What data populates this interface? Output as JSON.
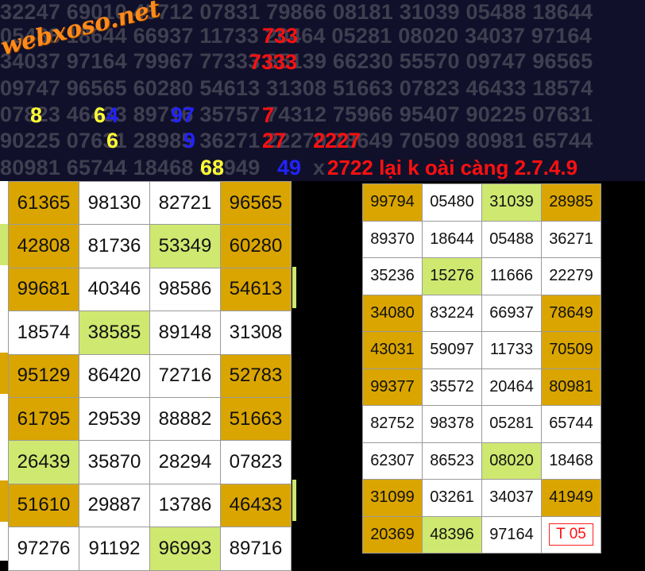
{
  "logo_text": "webxoso.net",
  "bg_rows": [
    "32247 69010 45712 07831 79866 08181 31039 05488 18644",
    "05488 18644 66937 11733 20464 05281 08020 34037 97164",
    "34037 97164 79967 77333 85139 66230 55570 09747 96565",
    "09747 96565 60280 54613 31308 51663 07823 46433 18574",
    "07823 46433 89716 35757 74312 75966 95407 90225 07631",
    "90225 07631 28985 36271 22279 78649 70509 80981 65744",
    "80981 65744 18468 41949"
  ],
  "highlights": {
    "r1": "733",
    "r2": "7333",
    "r4_8": "8",
    "r4_6": "6",
    "r4_4": "4",
    "r4_97": "97",
    "r4_7": "7",
    "r5_6": "6",
    "r5_9": "9",
    "r5_27": "27",
    "r5_2227": "2227",
    "r6_68": "68",
    "r6_49": "49",
    "r6_x": "x",
    "r6_note": "2722 lại k oài càng 2.7.4.9"
  },
  "colors": {
    "orange": "#daa500",
    "green": "#cfe870",
    "white": "#ffffff"
  },
  "left_table": [
    [
      [
        "61365",
        "o"
      ],
      [
        "98130",
        "w"
      ],
      [
        "82721",
        "w"
      ],
      [
        "96565",
        "o"
      ]
    ],
    [
      [
        "42808",
        "o"
      ],
      [
        "81736",
        "w"
      ],
      [
        "53349",
        "g"
      ],
      [
        "60280",
        "o"
      ]
    ],
    [
      [
        "99681",
        "o"
      ],
      [
        "40346",
        "w"
      ],
      [
        "98586",
        "w"
      ],
      [
        "54613",
        "o"
      ]
    ],
    [
      [
        "18574",
        "w"
      ],
      [
        "38585",
        "g"
      ],
      [
        "89148",
        "w"
      ],
      [
        "31308",
        "w"
      ]
    ],
    [
      [
        "95129",
        "o"
      ],
      [
        "86420",
        "w"
      ],
      [
        "72716",
        "w"
      ],
      [
        "52783",
        "o"
      ]
    ],
    [
      [
        "61795",
        "o"
      ],
      [
        "29539",
        "w"
      ],
      [
        "88882",
        "w"
      ],
      [
        "51663",
        "o"
      ]
    ],
    [
      [
        "26439",
        "g"
      ],
      [
        "35870",
        "w"
      ],
      [
        "28294",
        "w"
      ],
      [
        "07823",
        "w"
      ]
    ],
    [
      [
        "51610",
        "o"
      ],
      [
        "29887",
        "w"
      ],
      [
        "13786",
        "w"
      ],
      [
        "46433",
        "o"
      ]
    ],
    [
      [
        "97276",
        "w"
      ],
      [
        "91192",
        "w"
      ],
      [
        "96993",
        "g"
      ],
      [
        "89716",
        "w"
      ]
    ]
  ],
  "right_table": [
    [
      [
        "99794",
        "o"
      ],
      [
        "05480",
        "w"
      ],
      [
        "31039",
        "g"
      ],
      [
        "28985",
        "o"
      ]
    ],
    [
      [
        "89370",
        "w"
      ],
      [
        "18644",
        "w"
      ],
      [
        "05488",
        "w"
      ],
      [
        "36271",
        "w"
      ]
    ],
    [
      [
        "35236",
        "w"
      ],
      [
        "15276",
        "g"
      ],
      [
        "11666",
        "w"
      ],
      [
        "22279",
        "w"
      ]
    ],
    [
      [
        "34080",
        "o"
      ],
      [
        "83224",
        "w"
      ],
      [
        "66937",
        "w"
      ],
      [
        "78649",
        "o"
      ]
    ],
    [
      [
        "43031",
        "o"
      ],
      [
        "59097",
        "w"
      ],
      [
        "11733",
        "w"
      ],
      [
        "70509",
        "o"
      ]
    ],
    [
      [
        "99377",
        "o"
      ],
      [
        "35572",
        "w"
      ],
      [
        "20464",
        "w"
      ],
      [
        "80981",
        "o"
      ]
    ],
    [
      [
        "82752",
        "w"
      ],
      [
        "98378",
        "w"
      ],
      [
        "05281",
        "w"
      ],
      [
        "65744",
        "w"
      ]
    ],
    [
      [
        "62307",
        "w"
      ],
      [
        "86523",
        "w"
      ],
      [
        "08020",
        "g"
      ],
      [
        "18468",
        "w"
      ]
    ],
    [
      [
        "31099",
        "o"
      ],
      [
        "03261",
        "w"
      ],
      [
        "34037",
        "w"
      ],
      [
        "41949",
        "o"
      ]
    ],
    [
      [
        "20369",
        "o"
      ],
      [
        "48396",
        "g"
      ],
      [
        "97164",
        "w"
      ],
      [
        "T 05",
        "tag"
      ]
    ]
  ]
}
